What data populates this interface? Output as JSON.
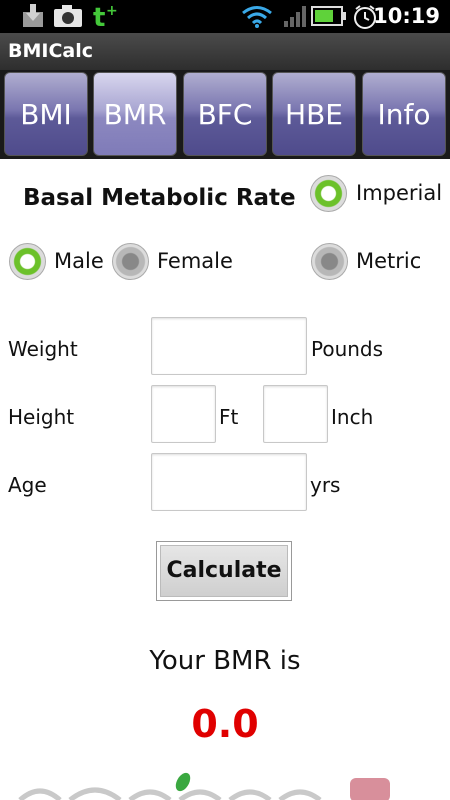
{
  "status_bar": {
    "time": "10:19",
    "icons": [
      "download-icon",
      "camera-icon",
      "tumblr-icon",
      "wifi-icon",
      "signal-icon",
      "battery-icon",
      "alarm-icon"
    ]
  },
  "app": {
    "title": "BMICalc"
  },
  "tabs": [
    {
      "label": "BMI",
      "selected": false
    },
    {
      "label": "BMR",
      "selected": true
    },
    {
      "label": "BFC",
      "selected": false
    },
    {
      "label": "HBE",
      "selected": false
    },
    {
      "label": "Info",
      "selected": false
    }
  ],
  "form": {
    "heading": "Basal Metabolic Rate",
    "units": {
      "imperial_label": "Imperial",
      "metric_label": "Metric",
      "selected": "Imperial"
    },
    "gender": {
      "male_label": "Male",
      "female_label": "Female",
      "selected": "Male"
    },
    "weight": {
      "label": "Weight",
      "value": "",
      "unit": "Pounds"
    },
    "height": {
      "label": "Height",
      "ft_value": "",
      "ft_unit": "Ft",
      "inch_value": "",
      "inch_unit": "Inch"
    },
    "age": {
      "label": "Age",
      "value": "",
      "unit": "yrs"
    },
    "calculate_label": "Calculate"
  },
  "result": {
    "label": "Your BMR is",
    "value": "0.0"
  },
  "colors": {
    "accent_green": "#6cc12a",
    "result_red": "#e00000",
    "tab_purple": "#5d5a98"
  }
}
